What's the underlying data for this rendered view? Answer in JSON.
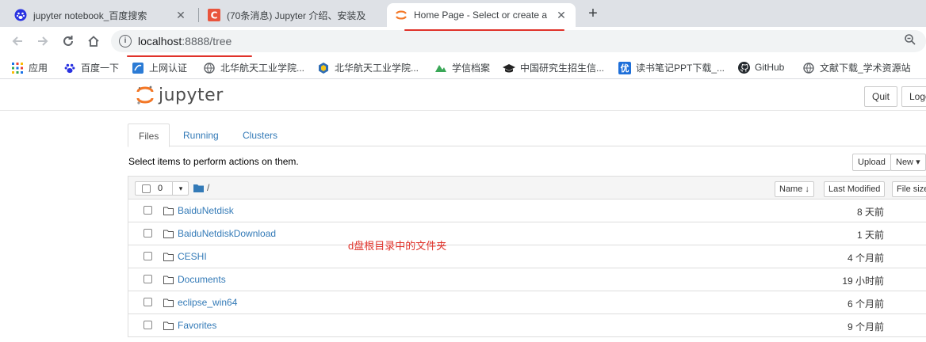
{
  "browser": {
    "tabs": [
      {
        "title": "jupyter notebook_百度搜索",
        "icon": "baidu-paw-icon",
        "active": false
      },
      {
        "title": "(70条消息) Jupyter 介绍、安装及",
        "icon": "csdn-c-icon",
        "active": false
      },
      {
        "title": "Home Page - Select or create a",
        "icon": "jupyter-icon",
        "active": true
      }
    ],
    "new_tab": "+",
    "close": "✕",
    "address": {
      "host": "localhost",
      "rest": ":8888/tree"
    },
    "bookmarks": [
      {
        "label": "应用",
        "icon": "apps-grid-icon"
      },
      {
        "label": "百度一下",
        "icon": "baidu-paw-icon"
      },
      {
        "label": "上网认证",
        "icon": "network-auth-icon"
      },
      {
        "label": "北华航天工业学院...",
        "icon": "globe-icon"
      },
      {
        "label": "北华航天工业学院...",
        "icon": "college-icon"
      },
      {
        "label": "学信档案",
        "icon": "chsi-icon"
      },
      {
        "label": "中国研究生招生信...",
        "icon": "mortarboard-icon"
      },
      {
        "label": "读书笔记PPT下载_...",
        "icon": "you-icon"
      },
      {
        "label": "GitHub",
        "icon": "github-icon"
      },
      {
        "label": "文献下载_学术资源站",
        "icon": "globe-icon"
      }
    ],
    "bookmark_you_glyph": "优"
  },
  "jupyter": {
    "logo_text": "jupyter",
    "quit_label": "Quit",
    "logout_label": "Logo",
    "tabs": [
      "Files",
      "Running",
      "Clusters"
    ],
    "hint": "Select items to perform actions on them.",
    "upload_label": "Upload",
    "new_label": "New",
    "selected_count": "0",
    "breadcrumb": "/",
    "columns": {
      "name": "Name",
      "last_modified": "Last Modified",
      "file_size": "File size"
    },
    "files": [
      {
        "name": "BaiduNetdisk",
        "modified": "8 天前"
      },
      {
        "name": "BaiduNetdiskDownload",
        "modified": "1 天前"
      },
      {
        "name": "CESHI",
        "modified": "4 个月前"
      },
      {
        "name": "Documents",
        "modified": "19 小时前"
      },
      {
        "name": "eclipse_win64",
        "modified": "6 个月前"
      },
      {
        "name": "Favorites",
        "modified": "9 个月前"
      }
    ]
  },
  "annotation": {
    "note": "d盘根目录中的文件夹"
  },
  "colors": {
    "link": "#337ab7",
    "annotation_red": "#e0322a",
    "jupyter_orange": "#f37726"
  }
}
